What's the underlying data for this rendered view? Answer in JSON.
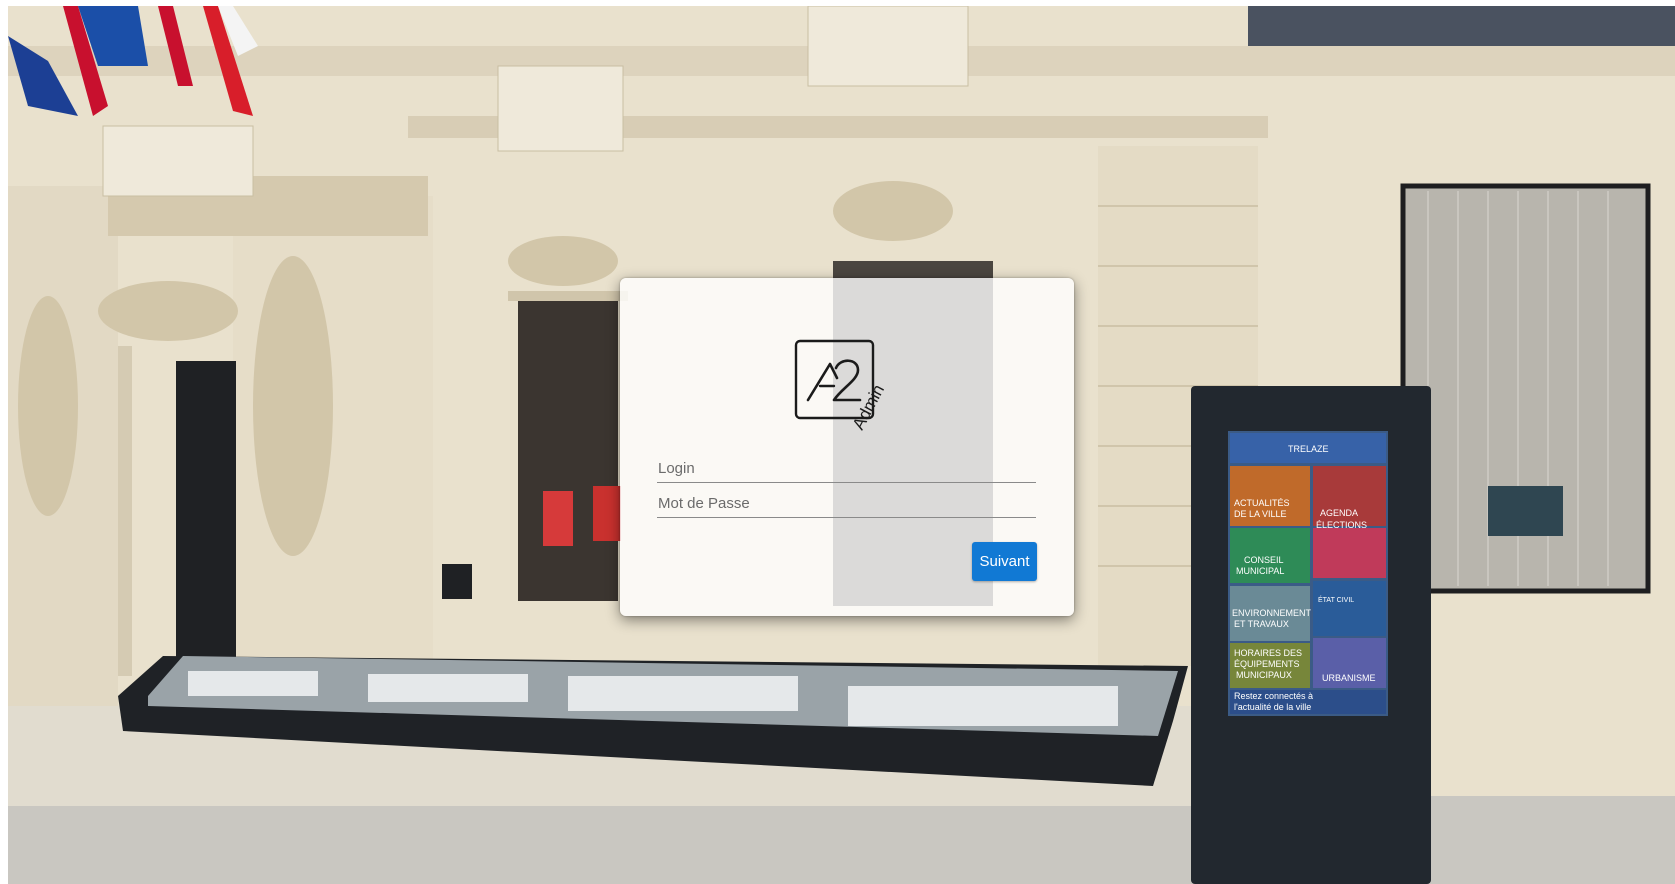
{
  "logo": {
    "mark_text": "A2",
    "sub_text": "Admin"
  },
  "form": {
    "login_placeholder": "Login",
    "password_placeholder": "Mot de Passe",
    "submit_label": "Suivant"
  },
  "kiosk": {
    "header": "TRELAZE",
    "tiles": [
      "ACTUALITÉS DE LA VILLE",
      "AGENDA ÉLECTIONS",
      "CONSEIL MUNICIPAL",
      "ÉTAT CIVIL",
      "ENVIRONNEMENT ET TRAVAUX",
      "HORAIRES DES ÉQUIPEMENTS MUNICIPAUX",
      "URBANISME"
    ],
    "footer": "Restez connectés à l'actualité de la ville"
  },
  "colors": {
    "button": "#1179d4",
    "card": "rgba(255,255,255,0.80)"
  }
}
